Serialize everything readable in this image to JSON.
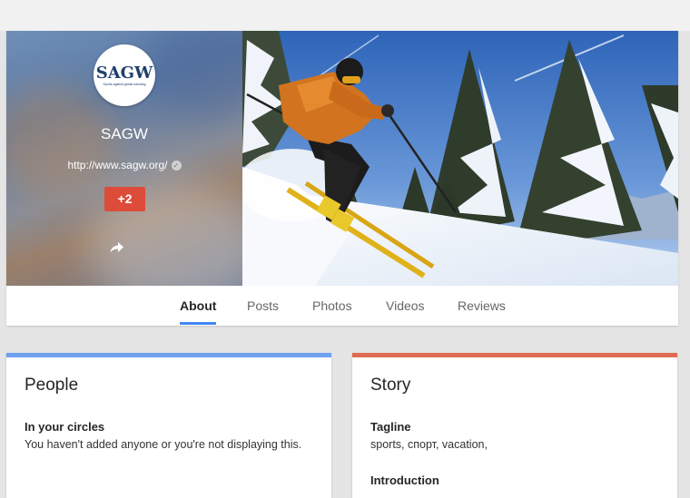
{
  "page": {
    "name": "SAGW",
    "logo_text": "SAGW",
    "logo_subtext": "Sports against global warming",
    "website": "http://www.sagw.org/",
    "plus_label": "+2"
  },
  "tabs": [
    {
      "label": "About",
      "active": true
    },
    {
      "label": "Posts",
      "active": false
    },
    {
      "label": "Photos",
      "active": false
    },
    {
      "label": "Videos",
      "active": false
    },
    {
      "label": "Reviews",
      "active": false
    }
  ],
  "cards": {
    "people": {
      "title": "People",
      "section_label": "In your circles",
      "section_text": "You haven't added anyone or you're not displaying this.",
      "accent": "#6ea1f0"
    },
    "story": {
      "title": "Story",
      "section_label": "Tagline",
      "section_text": "sports, спорт, vacation,",
      "next_label": "Introduction",
      "accent": "#e06b55"
    }
  },
  "colors": {
    "plus_button": "#dd4b39",
    "tab_underline": "#4285f4",
    "background": "#e5e5e5"
  },
  "icons": [
    "verified-icon",
    "share-icon"
  ]
}
